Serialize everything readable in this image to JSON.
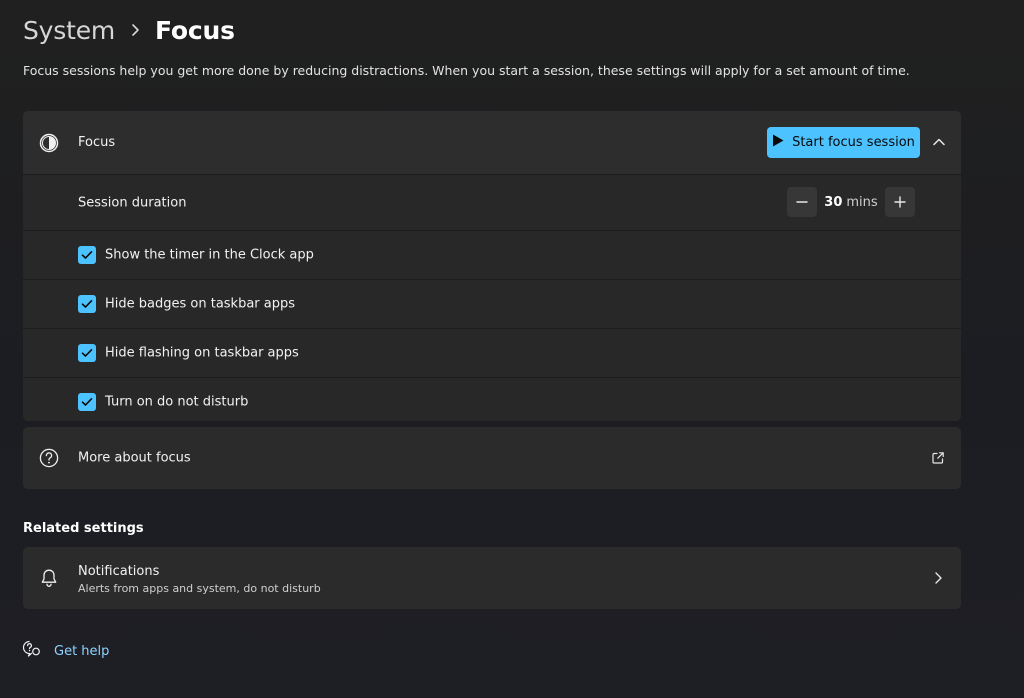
{
  "breadcrumb": {
    "parent": "System",
    "current": "Focus"
  },
  "description": "Focus sessions help you get more done by reducing distractions. When you start a session, these settings will apply for a set amount of time.",
  "focus": {
    "label": "Focus",
    "icon": "focus-icon",
    "start_button_label": "Start focus session",
    "expanded": true,
    "session_duration": {
      "label": "Session duration",
      "value": "30",
      "unit": "mins"
    },
    "options": [
      {
        "label": "Show the timer in the Clock app",
        "checked": true
      },
      {
        "label": "Hide badges on taskbar apps",
        "checked": true
      },
      {
        "label": "Hide flashing on taskbar apps",
        "checked": true
      },
      {
        "label": "Turn on do not disturb",
        "checked": true
      }
    ]
  },
  "about": {
    "label": "More about focus",
    "icon": "help-circle-icon",
    "action_icon": "external-link-icon"
  },
  "related": {
    "title": "Related settings",
    "notifications": {
      "title": "Notifications",
      "subtitle": "Alerts from apps and system, do not disturb",
      "icon": "bell-icon"
    }
  },
  "help": {
    "label": "Get help",
    "icon": "get-help-icon"
  },
  "colors": {
    "accent": "#4cc2ff",
    "background": "#202020",
    "card": "#2b2b2b",
    "link": "#8cd3ff"
  }
}
